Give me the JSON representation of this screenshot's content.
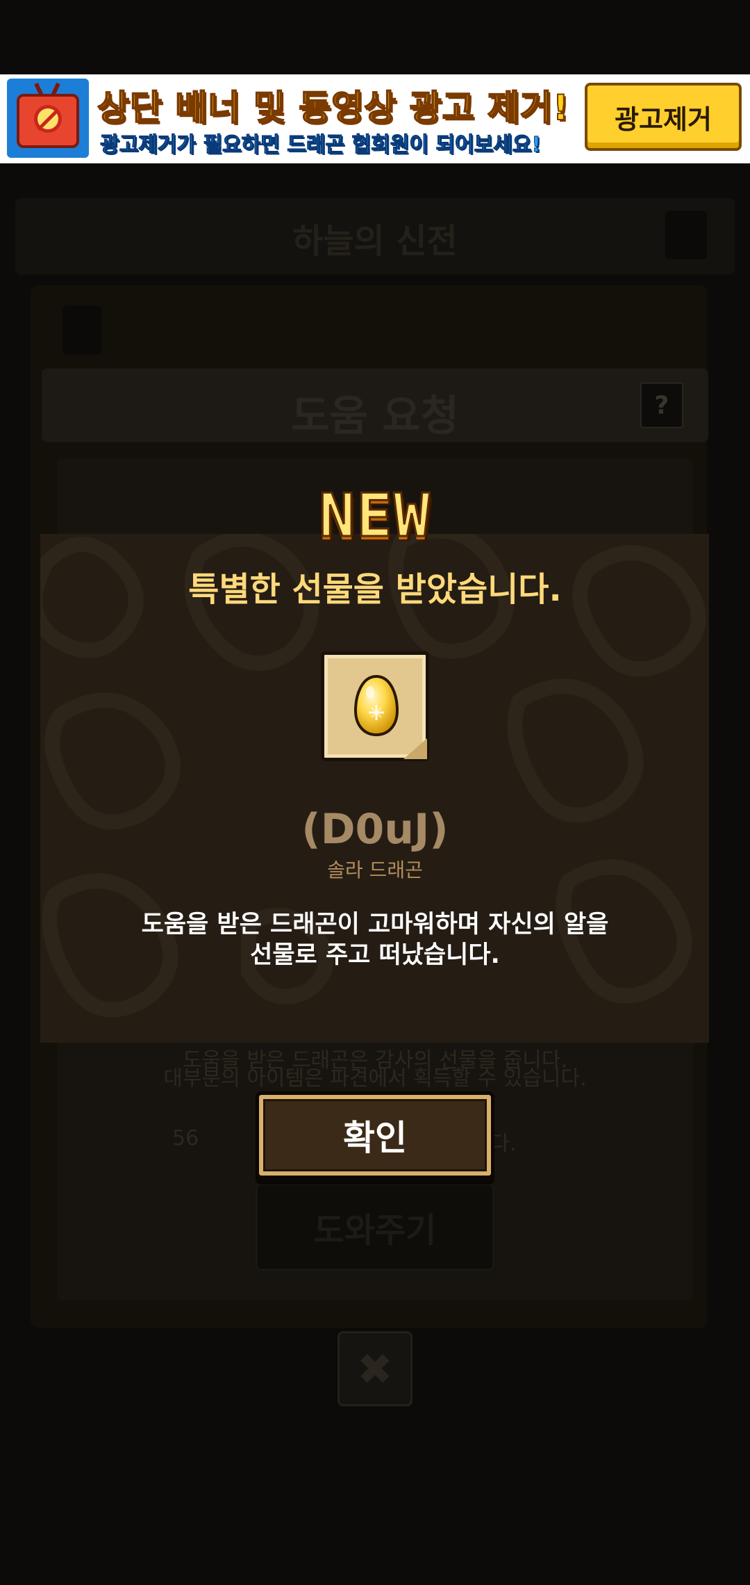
{
  "ad_banner": {
    "title": "상단 배너 및 동영상 광고 제거!",
    "subtitle": "광고제거가 필요하면 드래곤 협회원이 되어보세요!",
    "remove_button": "광고제거",
    "icon": "no-ads-tv-icon"
  },
  "background": {
    "header_title": "하늘의 신전",
    "help_title": "도움 요청",
    "help_question": "?",
    "notice_line_1": "도움을 받은 드래곤은 감사의 선물을 줍니다.",
    "notice_line_2": "대부분의 아이템은 파견에서 획득할 수 있습니다.",
    "count_prefix": "56",
    "count_suffix": "다.",
    "help_button": "도와주기",
    "close_icon": "close-icon"
  },
  "modal": {
    "badge": "NEW",
    "title": "특별한 선물을 받았습니다.",
    "item": {
      "icon": "golden-egg-icon",
      "code": "(D0uJ)",
      "name": "솔라 드래곤"
    },
    "desc_line_1": "도움을 받은 드래곤이 고마워하며 자신의 알을",
    "desc_line_2": "선물로 주고 떠났습니다.",
    "confirm_button": "확인"
  },
  "colors": {
    "modal_bg": "#251d14",
    "title_gold": "#ffd97a",
    "ad_yellow": "#ffd31a",
    "ad_blue": "#2a9ff5"
  }
}
